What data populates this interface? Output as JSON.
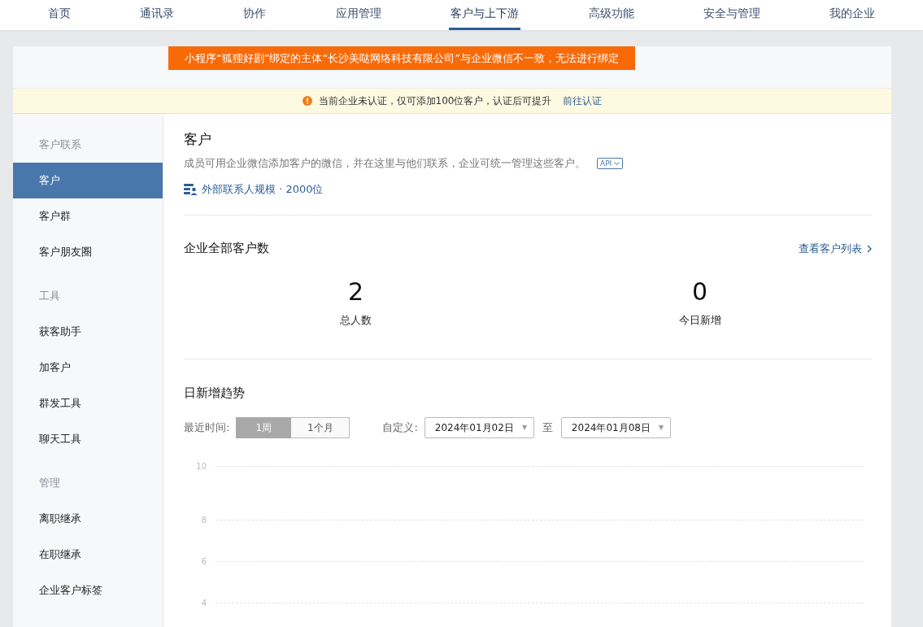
{
  "nav": [
    {
      "label": "首页",
      "selected": false
    },
    {
      "label": "通讯录",
      "selected": false
    },
    {
      "label": "协作",
      "selected": false
    },
    {
      "label": "应用管理",
      "selected": false
    },
    {
      "label": "客户与上下游",
      "selected": true
    },
    {
      "label": "高级功能",
      "selected": false
    },
    {
      "label": "安全与管理",
      "selected": false
    },
    {
      "label": "我的企业",
      "selected": false
    }
  ],
  "toast": "小程序“狐狸好剧”绑定的主体“长沙美哒网络科技有限公司”与企业微信不一致，无法进行绑定",
  "notice": {
    "text": "当前企业未认证，仅可添加100位客户，认证后可提升",
    "link": "前往认证"
  },
  "sidebar": [
    {
      "heading": "客户联系",
      "items": [
        {
          "label": "客户",
          "selected": true
        },
        {
          "label": "客户群",
          "selected": false
        },
        {
          "label": "客户朋友圈",
          "selected": false
        }
      ]
    },
    {
      "heading": "工具",
      "items": [
        {
          "label": "获客助手",
          "selected": false
        },
        {
          "label": "加客户",
          "selected": false
        },
        {
          "label": "群发工具",
          "selected": false
        },
        {
          "label": "聊天工具",
          "selected": false
        }
      ]
    },
    {
      "heading": "管理",
      "items": [
        {
          "label": "离职继承",
          "selected": false
        },
        {
          "label": "在职继承",
          "selected": false
        },
        {
          "label": "企业客户标签",
          "selected": false
        }
      ]
    }
  ],
  "customers": {
    "title": "客户",
    "description": "成员可用企业微信添加客户的微信，并在这里与他们联系，企业可统一管理这些客户。",
    "api_badge": "API",
    "scale": "外部联系人规模 · 2000位"
  },
  "totals": {
    "title": "企业全部客户数",
    "link": "查看客户列表",
    "stats": [
      {
        "value": "2",
        "label": "总人数"
      },
      {
        "value": "0",
        "label": "今日新增"
      }
    ]
  },
  "trend": {
    "title": "日新增趋势",
    "range_label": "最近时间:",
    "ranges": [
      {
        "label": "1周",
        "selected": true
      },
      {
        "label": "1个月",
        "selected": false
      }
    ],
    "custom_label": "自定义:",
    "start_date": "2024年01月02日",
    "to_label": "至",
    "end_date": "2024年01月08日",
    "axis_labels": [
      "10",
      "8",
      "6",
      "4"
    ]
  }
}
